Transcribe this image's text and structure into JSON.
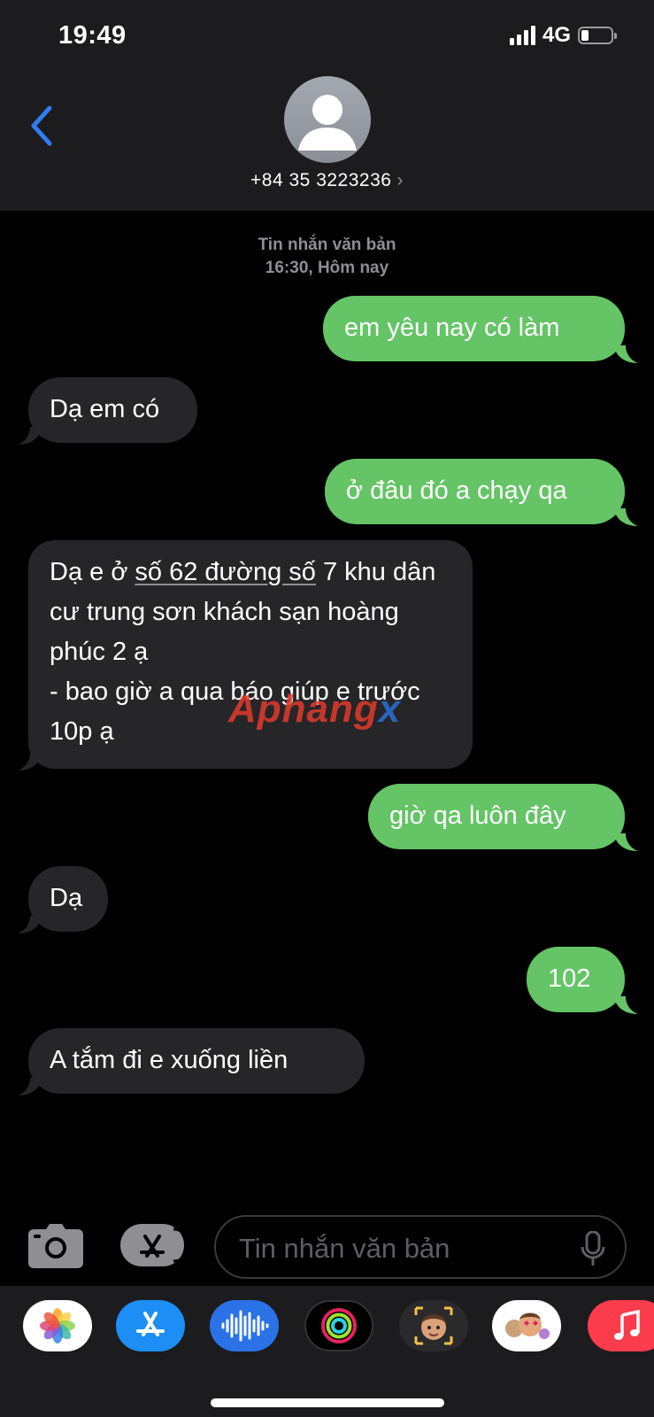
{
  "status_bar": {
    "time": "19:49",
    "network": "4G",
    "battery_level": 0.25
  },
  "header": {
    "contact": "+84 35 3223236",
    "chevron": "›"
  },
  "thread": {
    "label": "Tin nhắn văn bản",
    "timestamp": "16:30, Hôm nay"
  },
  "messages": [
    {
      "dir": "sent",
      "text": "em yêu nay có làm"
    },
    {
      "dir": "received",
      "text": "Dạ em có"
    },
    {
      "dir": "sent",
      "text": "ở đâu đó a chạy qa"
    },
    {
      "dir": "received",
      "text_before": " Dạ e ở ",
      "text_link": "số 62 đường số",
      "text_after": " 7 khu dân cư trung sơn khách sạn hoàng phúc 2 ạ",
      "text_line2": "- bao giờ a qua báo giúp e trước 10p ạ"
    },
    {
      "dir": "sent",
      "text": "giờ qa luôn đây"
    },
    {
      "dir": "received",
      "text": "Dạ"
    },
    {
      "dir": "sent",
      "text": "102"
    },
    {
      "dir": "received",
      "text": "A tắm đi e xuống liền"
    }
  ],
  "watermark": {
    "part1": "Aphang",
    "part2": "x"
  },
  "composer": {
    "placeholder": "Tin nhắn văn bản"
  },
  "app_drawer": {
    "apps": [
      "photos-icon",
      "app-store-icon",
      "audio-message-icon",
      "activity-icon",
      "memoji-icon",
      "memoji-stickers-icon",
      "music-icon"
    ]
  },
  "colors": {
    "sent_bubble": "#65c466",
    "received_bubble": "#262628",
    "accent": "#2f7cf6"
  }
}
